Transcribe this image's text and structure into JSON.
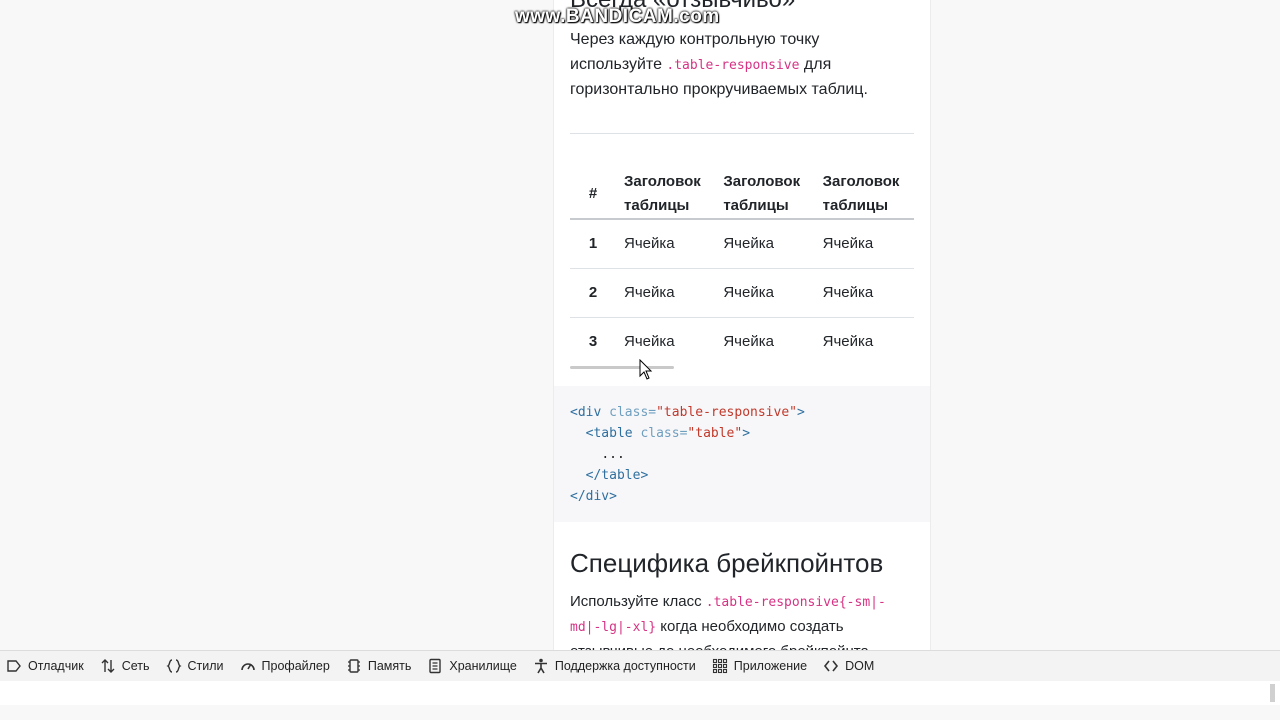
{
  "watermark": "www.BANDICAM.com",
  "content": {
    "top_heading": "Всегда «отзывчиво»",
    "intro": {
      "before": "Через каждую контрольную точку используйте ",
      "code": ".table-responsive",
      "after": " для горизонтально прокручиваемых таблиц."
    },
    "table": {
      "headers": [
        "#",
        "Заголовок таблицы",
        "Заголовок таблицы",
        "Заголовок таблицы"
      ],
      "rows": [
        [
          "1",
          "Ячейка",
          "Ячейка",
          "Ячейка"
        ],
        [
          "2",
          "Ячейка",
          "Ячейка",
          "Ячейка"
        ],
        [
          "3",
          "Ячейка",
          "Ячейка",
          "Ячейка"
        ]
      ]
    },
    "code_lines": [
      "<div class=\"table-responsive\">",
      "  <table class=\"table\">",
      "    ...",
      "  </table>",
      "</div>"
    ],
    "section_heading": "Специфика брейкпойнтов",
    "section_text": {
      "before": "Используйте класс ",
      "code": ".table-responsive{-sm|-md|-lg|-xl}",
      "after": " когда необходимо создать отзывчивые до необходимого брейкпойнта"
    }
  },
  "devtools": {
    "tabs": [
      {
        "label": "Отладчик",
        "icon": "debugger-icon"
      },
      {
        "label": "Сеть",
        "icon": "network-icon"
      },
      {
        "label": "Стили",
        "icon": "braces-icon"
      },
      {
        "label": "Профайлер",
        "icon": "gauge-icon"
      },
      {
        "label": "Память",
        "icon": "memory-chip-icon"
      },
      {
        "label": "Хранилище",
        "icon": "storage-icon"
      },
      {
        "label": "Поддержка доступности",
        "icon": "accessibility-icon"
      },
      {
        "label": "Приложение",
        "icon": "app-grid-icon"
      },
      {
        "label": "DOM",
        "icon": "dom-icon"
      }
    ]
  },
  "colors": {
    "inline_code": "#d63384",
    "code_tag": "#2f6f9f",
    "code_attr": "#6f9fbf",
    "code_value": "#c0392b",
    "code_background": "#f7f7f9"
  }
}
